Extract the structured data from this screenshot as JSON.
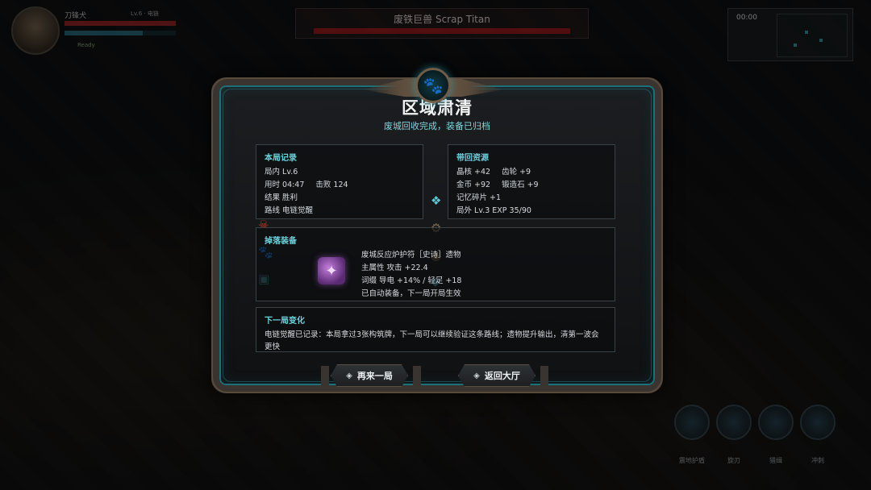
{
  "hud": {
    "player_name": "刀锋犬",
    "player_level": "Lv.6 · 电链",
    "status": "Ready"
  },
  "boss": {
    "name": "废铁巨兽  Scrap Titan"
  },
  "minimap": {
    "time": "00:00"
  },
  "skills": [
    {
      "label": "震地护盾",
      "icon": "shield-icon"
    },
    {
      "label": "旋刃",
      "icon": "blade-icon"
    },
    {
      "label": "猎缉",
      "icon": "hunt-icon"
    },
    {
      "label": "冲刺",
      "icon": "dash-icon"
    }
  ],
  "panel": {
    "title": "区域肃清",
    "subtitle": "废城回收完成，装备已归档",
    "record": {
      "heading": "本局记录",
      "level": "局内 Lv.6",
      "time": "用时 04:47",
      "kills": "击败 124",
      "result": "结果 胜利",
      "route": "路线 电链觉醒"
    },
    "resources": {
      "heading": "带回资源",
      "crystal": "晶核 +42",
      "gear": "齿轮 +9",
      "gold": "金币 +92",
      "forge": "锻造石 +9",
      "memory": "记忆碎片 +1",
      "meta": "局外 Lv.3  EXP 35/90"
    },
    "drop": {
      "heading": "掉落装备",
      "name": "废城反应炉护符［史诗］遗物",
      "main_stat": "主属性 攻击 +22.4",
      "affix": "词缀 导电 +14% / 轻足 +18",
      "note": "已自动装备，下一局开局生效"
    },
    "next": {
      "heading": "下一局变化",
      "text": "电链觉醒已记录：本局拿过3张构筑牌，下一局可以继续验证这条路线；遗物提升输出，清第一波会更快"
    },
    "buttons": {
      "retry": "再来一局",
      "lobby": "返回大厅"
    }
  },
  "colors": {
    "accent": "#6fd0db",
    "frame": "#3a3430",
    "boss_bar": "#8e1414",
    "epic": "#b46cd4"
  }
}
